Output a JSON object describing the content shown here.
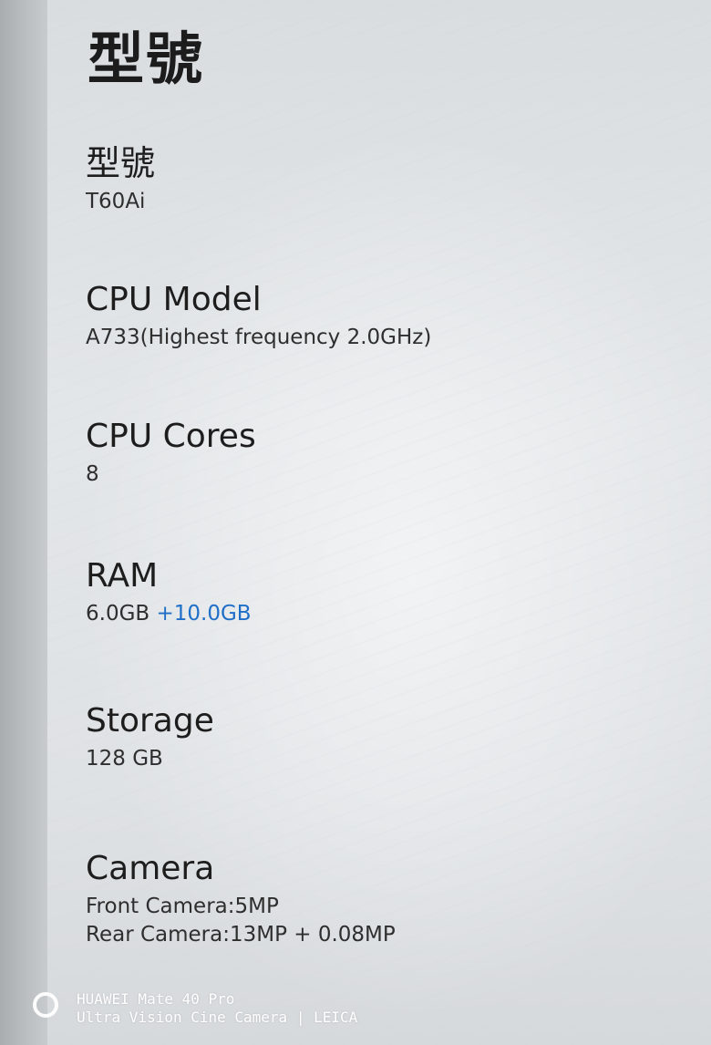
{
  "page": {
    "title": "型號"
  },
  "specs": [
    {
      "label": "型號",
      "value": "T60Ai"
    },
    {
      "label": "CPU Model",
      "value": "A733(Highest frequency 2.0GHz)"
    },
    {
      "label": "CPU Cores",
      "value": "8"
    },
    {
      "label": "RAM",
      "value": "6.0GB",
      "extra": "+10.0GB"
    },
    {
      "label": "Storage",
      "value": "128 GB"
    },
    {
      "label": "Camera",
      "value": "Front Camera:5MP",
      "value2": "Rear Camera:13MP + 0.08MP"
    }
  ],
  "watermark": {
    "line1": "HUAWEI Mate 40 Pro",
    "line2": "Ultra Vision Cine Camera | LEICA"
  },
  "colors": {
    "accent": "#1f6fc8",
    "label": "#1d1d1d",
    "value": "#2e2e2e"
  }
}
